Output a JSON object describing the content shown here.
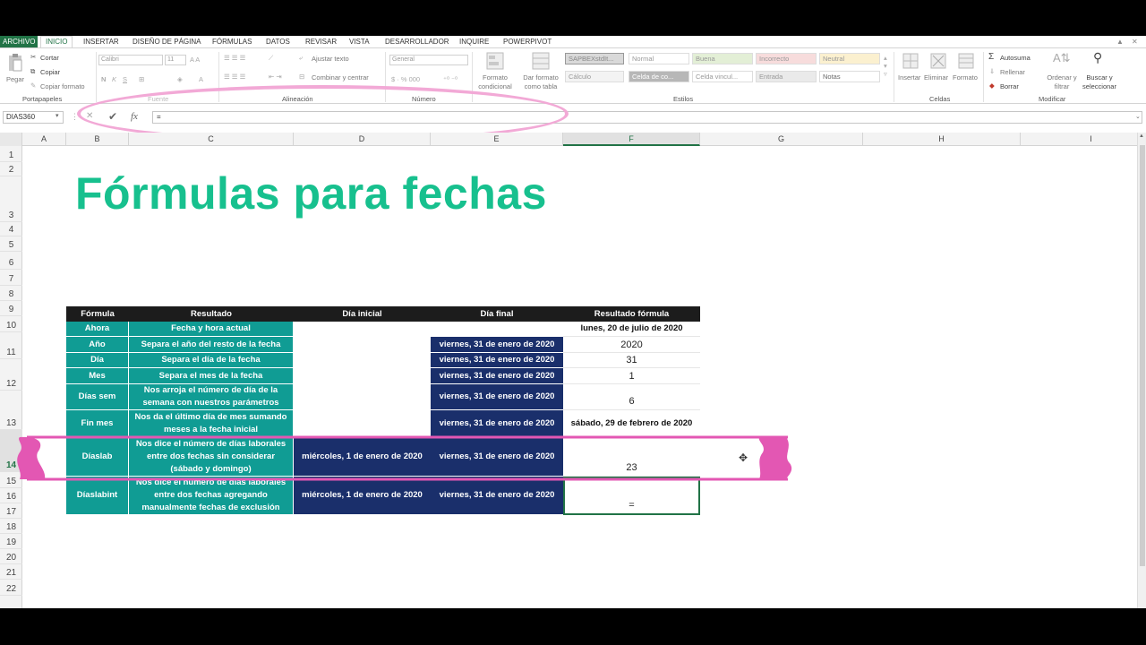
{
  "ribbon_tabs": [
    "ARCHIVO",
    "INICIO",
    "INSERTAR",
    "DISEÑO DE PÁGINA",
    "FÓRMULAS",
    "DATOS",
    "REVISAR",
    "VISTA",
    "DESARROLLADOR",
    "INQUIRE",
    "POWERPIVOT"
  ],
  "clipboard": {
    "paste": "Pegar",
    "cut": "Cortar",
    "copy": "Copiar",
    "format_painter": "Copiar formato",
    "label": "Portapapeles"
  },
  "font": {
    "name": "Calibri",
    "size": "11",
    "label": "Fuente"
  },
  "alignment": {
    "wrap": "Ajustar texto",
    "merge": "Combinar y centrar",
    "label": "Alineación"
  },
  "number": {
    "format": "General",
    "label": "Número"
  },
  "styles": {
    "conditional": "Formato condicional",
    "as_table": "Dar formato como tabla",
    "cells": [
      "SAPBEXstdIt...",
      "Normal",
      "Buena",
      "Incorrecto",
      "Neutral",
      "Cálculo",
      "Celda de co...",
      "Celda vincul...",
      "Entrada",
      "Notas"
    ],
    "label": "Estilos"
  },
  "cells_group": {
    "insert": "Insertar",
    "delete": "Eliminar",
    "format": "Formato",
    "label": "Celdas"
  },
  "editing": {
    "autosum": "Autosuma",
    "fill": "Rellenar",
    "clear": "Borrar",
    "sort": "Ordenar y filtrar",
    "find": "Buscar y seleccionar",
    "label": "Modificar"
  },
  "formula_bar": {
    "name_box": "DIAS360",
    "fx": "fx",
    "formula": "="
  },
  "columns": [
    "A",
    "B",
    "C",
    "D",
    "E",
    "F",
    "G",
    "H",
    "I"
  ],
  "rows": [
    "1",
    "2",
    "3",
    "4",
    "5",
    "6",
    "7",
    "8",
    "9",
    "10",
    "11",
    "12",
    "13",
    "14",
    "15",
    "16",
    "17",
    "18",
    "19",
    "20",
    "21",
    "22"
  ],
  "sheet_title": "Fórmulas para fechas",
  "table": {
    "headers": [
      "Fórmula",
      "Resultado",
      "Día inicial",
      "Día final",
      "Resultado fórmula"
    ],
    "rows": [
      {
        "formula": "Ahora",
        "resultado": "Fecha y hora actual",
        "inicial": "",
        "final": "",
        "res_formula": "lunes, 20 de julio de 2020"
      },
      {
        "formula": "Año",
        "resultado": "Separa el año del resto de la fecha",
        "inicial": "",
        "final": "viernes, 31 de enero de 2020",
        "res_formula": "2020"
      },
      {
        "formula": "Día",
        "resultado": "Separa el día de la fecha",
        "inicial": "",
        "final": "viernes, 31 de enero de 2020",
        "res_formula": "31"
      },
      {
        "formula": "Mes",
        "resultado": "Separa el mes de la fecha",
        "inicial": "",
        "final": "viernes, 31 de enero de 2020",
        "res_formula": "1"
      },
      {
        "formula": "Días sem",
        "resultado": "Nos arroja el número de día de la semana con nuestros parámetros",
        "inicial": "",
        "final": "viernes, 31 de enero de 2020",
        "res_formula": "6"
      },
      {
        "formula": "Fin mes",
        "resultado": "Nos da el último día de mes sumando meses a la fecha inicial",
        "inicial": "",
        "final": "viernes, 31 de enero de 2020",
        "res_formula": "sábado, 29 de febrero de 2020"
      },
      {
        "formula": "Díaslab",
        "resultado": "Nos dice el número de días laborales entre dos fechas sin considerar (sábado y domingo)",
        "inicial": "miércoles, 1 de enero de 2020",
        "final": "viernes, 31 de enero de 2020",
        "res_formula": "23"
      },
      {
        "formula": "Díaslabint",
        "resultado": "Nos dice el número de días laborales entre dos fechas agregando manualmente fechas de exclusión",
        "inicial": "miércoles, 1 de enero de 2020",
        "final": "viernes, 31 de enero de 2020",
        "res_formula": "="
      }
    ]
  },
  "colors": {
    "excel_green": "#217346",
    "teal": "#109c94",
    "navy": "#1a2f6b",
    "title": "#17c08e",
    "highlight": "#e357b3"
  }
}
